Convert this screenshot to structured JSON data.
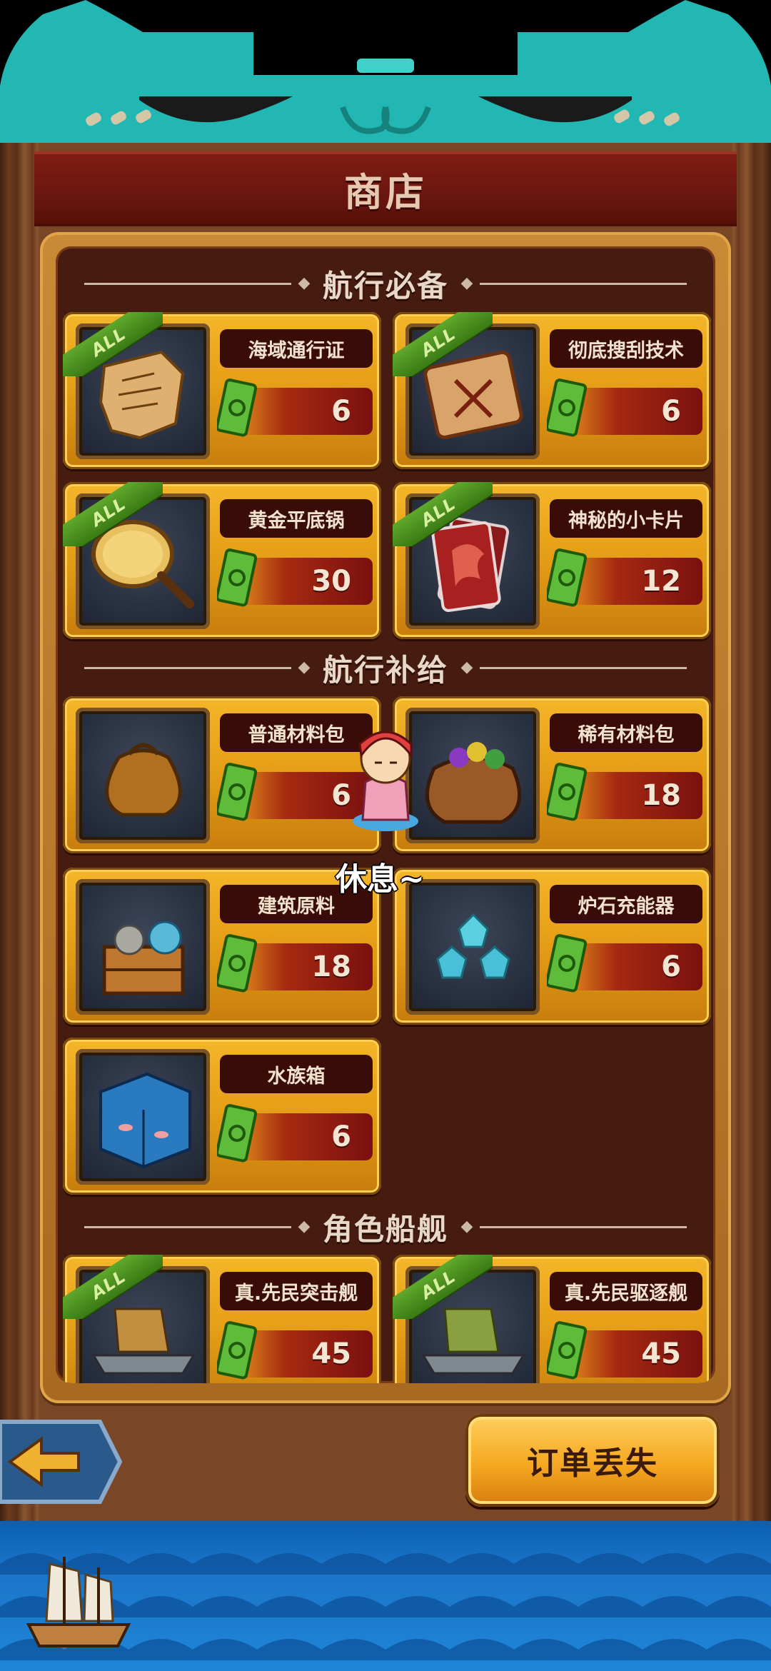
{
  "shop": {
    "title": "商店",
    "sections": [
      {
        "title": "航行必备",
        "items": [
          {
            "name": "海域通行证",
            "price": "6",
            "all": true,
            "icon": "map-scroll-icon"
          },
          {
            "name": "彻底搜刮技术",
            "price": "6",
            "all": true,
            "icon": "skill-scroll-icon"
          },
          {
            "name": "黄金平底锅",
            "price": "30",
            "all": true,
            "icon": "golden-pan-icon"
          },
          {
            "name": "神秘的小卡片",
            "price": "12",
            "all": true,
            "icon": "dragon-card-icon"
          }
        ]
      },
      {
        "title": "航行补给",
        "items": [
          {
            "name": "普通材料包",
            "price": "6",
            "all": false,
            "icon": "material-bag-icon"
          },
          {
            "name": "稀有材料包",
            "price": "18",
            "all": false,
            "icon": "rare-bag-icon"
          },
          {
            "name": "建筑原料",
            "price": "18",
            "all": false,
            "icon": "building-crate-icon"
          },
          {
            "name": "炉石充能器",
            "price": "6",
            "all": false,
            "icon": "crystal-charger-icon"
          },
          {
            "name": "水族箱",
            "price": "6",
            "all": false,
            "icon": "aquarium-icon"
          }
        ]
      },
      {
        "title": "角色船舰",
        "items": [
          {
            "name": "真.先民突击舰",
            "price": "45",
            "all": true,
            "icon": "assault-ship-icon"
          },
          {
            "name": "真.先民驱逐舰",
            "price": "45",
            "all": true,
            "icon": "destroyer-ship-icon"
          }
        ]
      }
    ],
    "all_badge": "ALL",
    "currency_icon": "cash-icon"
  },
  "npc": {
    "status": "休息~"
  },
  "footer": {
    "back_icon": "arrow-left-icon",
    "order_label": "订单丢失"
  },
  "colors": {
    "header_teal": "#1fb8b4",
    "banner_red": "#6a1610",
    "card_gold": "#e49d16",
    "price_red": "#7a1010",
    "sea_blue": "#1a74c8"
  }
}
